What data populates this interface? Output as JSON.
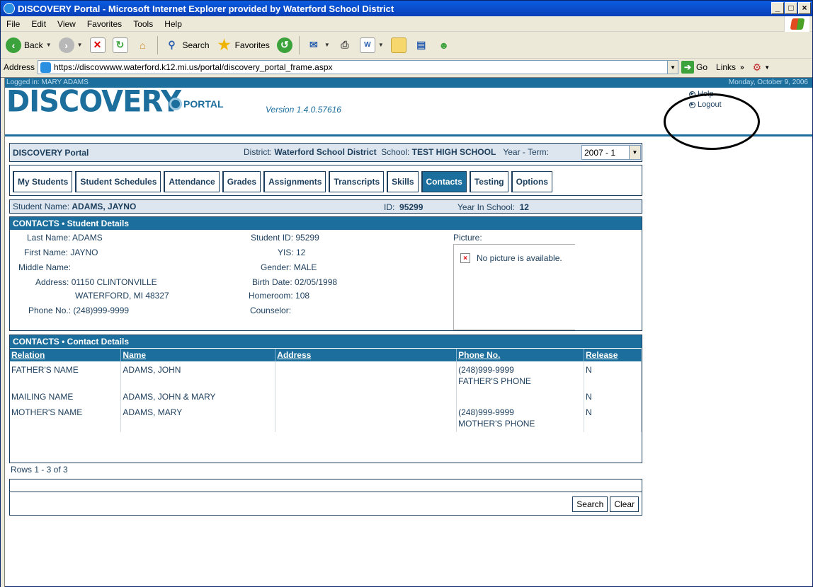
{
  "window": {
    "title": "DISCOVERY Portal - Microsoft Internet Explorer provided by Waterford School District"
  },
  "menu": [
    "File",
    "Edit",
    "View",
    "Favorites",
    "Tools",
    "Help"
  ],
  "toolbar": {
    "back": "Back",
    "search": "Search",
    "favorites": "Favorites"
  },
  "address": {
    "label": "Address",
    "url": "https://discovwww.waterford.k12.mi.us/portal/discovery_portal_frame.aspx",
    "go": "Go",
    "links": "Links"
  },
  "header": {
    "logged_in": "Logged in: MARY ADAMS",
    "date": "Monday, October 9, 2006",
    "logo": "DISCOVERY",
    "portal": "PORTAL",
    "version": "Version 1.4.0.57616",
    "help": "Help",
    "logout": "Logout"
  },
  "panel": {
    "title": "DISCOVERY Portal",
    "district_label": "District:",
    "district": "Waterford School District",
    "school_label": "School:",
    "school": "TEST HIGH SCHOOL",
    "term_label": "Year - Term:",
    "term": "2007 - 1"
  },
  "tabs": [
    "My Students",
    "Student Schedules",
    "Attendance",
    "Grades",
    "Assignments",
    "Transcripts",
    "Skills",
    "Contacts",
    "Testing",
    "Options"
  ],
  "active_tab": "Contacts",
  "student_bar": {
    "name_label": "Student Name:",
    "name": "ADAMS, JAYNO",
    "id_label": "ID:",
    "id": "95299",
    "yis_label": "Year In School:",
    "yis": "12"
  },
  "details": {
    "section": "CONTACTS",
    "subtitle": "Student Details",
    "last_name": "Last Name: ADAMS",
    "first_name": "First Name: JAYNO",
    "middle_name": "Middle Name:",
    "address1": "Address: 01150 CLINTONVILLE",
    "address2": "WATERFORD, MI 48327",
    "phone": "Phone No.: (248)999-9999",
    "student_id": "Student ID: 95299",
    "yis": "YIS: 12",
    "gender": "Gender: MALE",
    "birth_date": "Birth Date: 02/05/1998",
    "homeroom": "Homeroom: 108",
    "counselor": "Counselor:",
    "picture_label": "Picture:",
    "no_picture": "No picture is available."
  },
  "contacts": {
    "section": "CONTACTS",
    "subtitle": "Contact Details",
    "columns": [
      "Relation",
      "Name",
      "Address",
      "Phone No.",
      "Release"
    ],
    "rows": [
      {
        "relation": "FATHER'S NAME",
        "name": "ADAMS, JOHN",
        "address": "",
        "phone": "(248)999-9999",
        "phone_note": "FATHER'S PHONE",
        "release": "N"
      },
      {
        "relation": "MAILING NAME",
        "name": "ADAMS, JOHN & MARY",
        "address": "",
        "phone": "",
        "phone_note": "",
        "release": "N"
      },
      {
        "relation": "MOTHER'S NAME",
        "name": "ADAMS, MARY",
        "address": "",
        "phone": "(248)999-9999",
        "phone_note": "MOTHER'S PHONE",
        "release": "N"
      }
    ],
    "rows_count": "Rows 1 - 3 of 3"
  },
  "search": {
    "search_btn": "Search",
    "clear_btn": "Clear"
  },
  "icons": [
    "ie-icon",
    "back-icon",
    "forward-icon",
    "stop-icon",
    "refresh-icon",
    "home-icon",
    "search-icon",
    "favorites-icon",
    "history-icon",
    "mail-icon",
    "print-icon",
    "edit-icon",
    "folder-icon",
    "research-icon",
    "messenger-icon",
    "go-icon",
    "windows-logo-icon",
    "gear-icon",
    "broken-image-icon"
  ],
  "colors": {
    "portal_blue": "#1c6e9c",
    "portal_navy": "#1c3e5c",
    "panel_bg": "#dde6ef"
  }
}
